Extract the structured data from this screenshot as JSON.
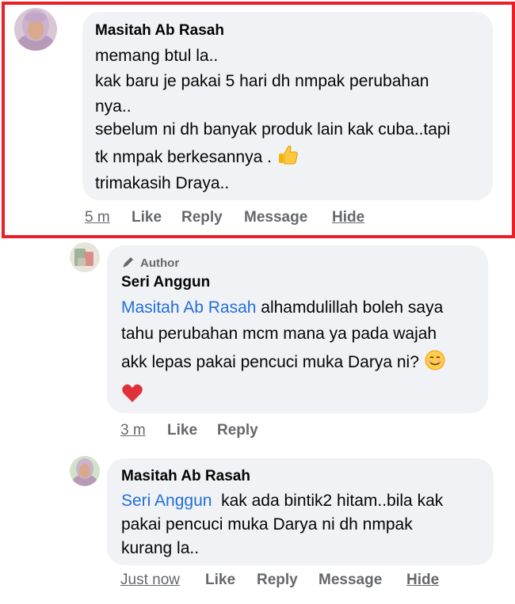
{
  "comment1": {
    "name": "Masitah Ab Rasah",
    "lines": [
      "memang btul la..",
      "kak baru je pakai 5 hari dh nmpak perubahan",
      "nya..",
      "sebelum ni dh banyak produk lain kak cuba..tapi",
      "tk nmpak berkesannya .",
      "trimakasih Draya.."
    ],
    "emoji": "thumbs-up-icon",
    "time": "5 m",
    "like": "Like",
    "reply": "Reply",
    "message": "Message",
    "hide": "Hide"
  },
  "comment2": {
    "author_badge": "Author",
    "name": "Seri Anggun",
    "mention": "Masitah Ab Rasah",
    "line1_rest": " alhamdulillah boleh saya",
    "line2": "tahu perubahan mcm mana ya pada wajah",
    "line3": "akk lepas pakai pencuci muka Darya ni? ",
    "emoji1": "smiling-face-icon",
    "emoji2": "red-heart-icon",
    "time": "3 m",
    "like": "Like",
    "reply": "Reply"
  },
  "comment3": {
    "name": "Masitah Ab Rasah",
    "mention": "Seri Anggun",
    "line1_rest": "  kak ada bintik2 hitam..bila kak",
    "line2": "pakai pencuci muka Darya ni dh nmpak",
    "line3": "kurang la..",
    "time": "Just now",
    "like": "Like",
    "reply": "Reply",
    "message": "Message",
    "hide": "Hide"
  },
  "colors": {
    "highlight_border": "#e8202a",
    "bubble_bg": "#f0f2f5",
    "mention": "#216fdb",
    "secondary_text": "#65676b"
  }
}
